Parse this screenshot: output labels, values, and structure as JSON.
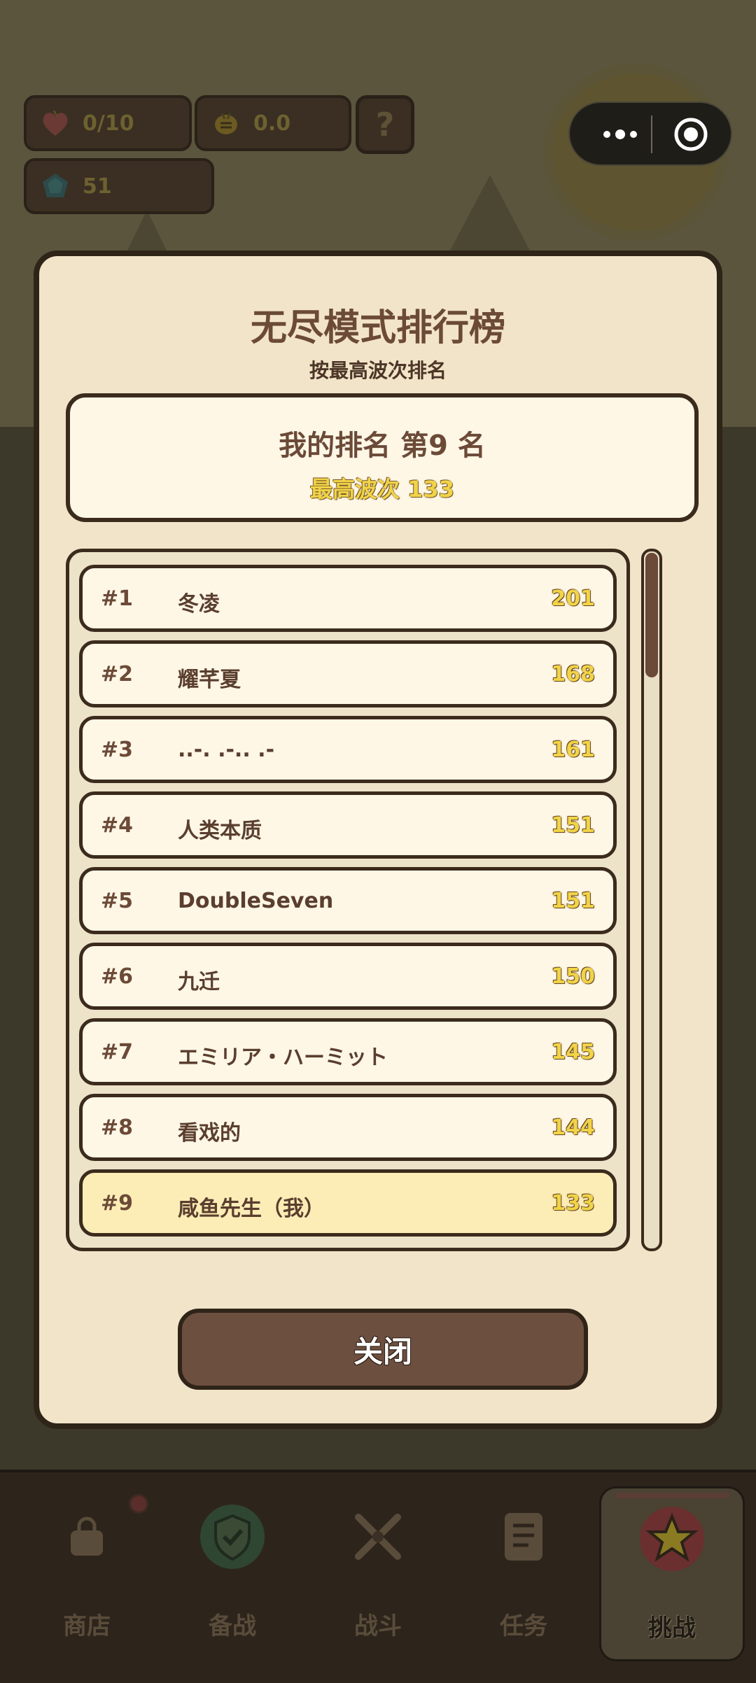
{
  "stats": {
    "hearts": "0/10",
    "coins": "0.0",
    "help": "?",
    "gems": "51"
  },
  "capsule": {
    "more_icon": "more-dots-icon",
    "close_icon": "record-circle-icon"
  },
  "modal": {
    "title": "无尽模式排行榜",
    "subtitle": "按最高波次排名",
    "my_rank": "我的排名 第9 名",
    "my_best_wave": "最高波次 133",
    "close_label": "关闭"
  },
  "leaderboard": [
    {
      "rank": "#1",
      "name": "冬凌",
      "score": "201"
    },
    {
      "rank": "#2",
      "name": "耀芊夏",
      "score": "168"
    },
    {
      "rank": "#3",
      "name": "..-.  .-..  .-",
      "score": "161"
    },
    {
      "rank": "#4",
      "name": "人类本质",
      "score": "151"
    },
    {
      "rank": "#5",
      "name": "DoubleSeven",
      "score": "151"
    },
    {
      "rank": "#6",
      "name": "九迁",
      "score": "150"
    },
    {
      "rank": "#7",
      "name": "エミリア・ハーミット",
      "score": "145"
    },
    {
      "rank": "#8",
      "name": "看戏的",
      "score": "144"
    },
    {
      "rank": "#9",
      "name": "咸鱼先生（我）",
      "score": "133"
    }
  ],
  "nav": {
    "items": [
      {
        "label": "商店",
        "icon": "shop-bag-icon"
      },
      {
        "label": "备战",
        "icon": "shield-check-icon"
      },
      {
        "label": "战斗",
        "icon": "crossed-swords-icon"
      },
      {
        "label": "任务",
        "icon": "task-list-icon"
      },
      {
        "label": "挑战",
        "icon": "star-icon"
      }
    ],
    "active": "挑战"
  },
  "colors": {
    "modal_bg": "#f2e4c8",
    "outline": "#3b2b1d",
    "title_brown": "#6c4a38",
    "score_yellow": "#f1d447",
    "highlight_row": "#fcedb6",
    "close_button": "#6d4f40"
  }
}
